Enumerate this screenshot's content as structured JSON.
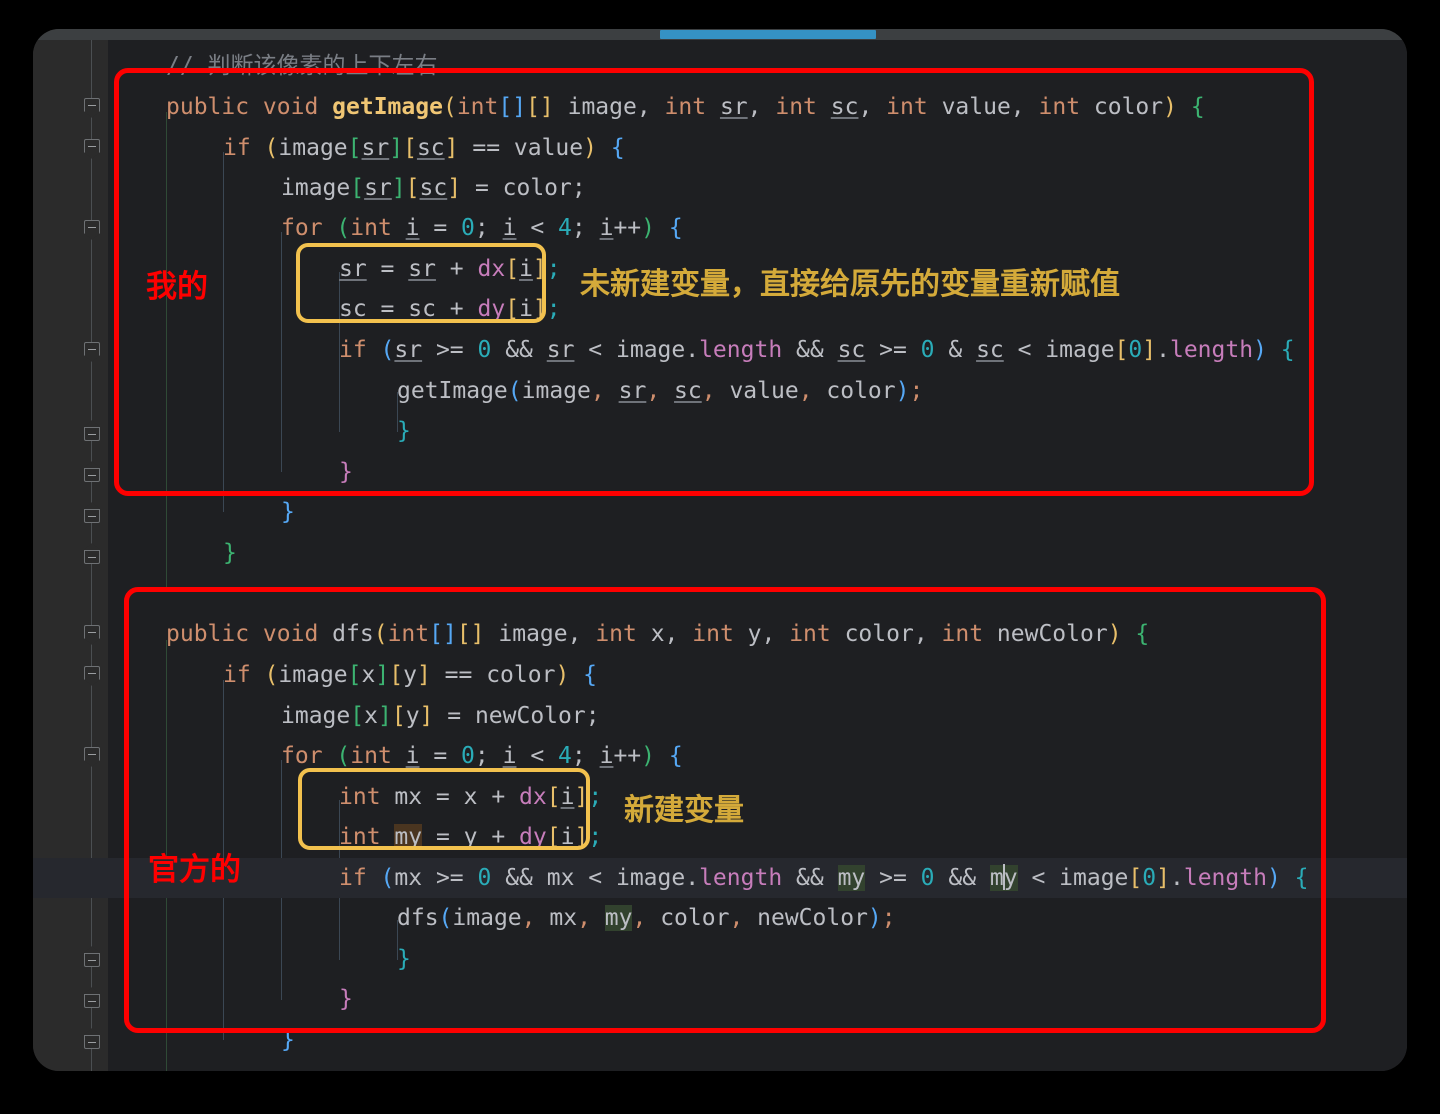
{
  "window": {
    "theme": "dark",
    "background_color": "#1e1f22",
    "chrome_color": "#2b2b2b"
  },
  "topbar": {
    "scrollbar_thumb_color": "#3592c4",
    "name": "horizontal-scrollbar"
  },
  "gutter": {
    "bulb_icon": "lightbulb-intention-icon",
    "fold_icon": "code-fold-icon"
  },
  "code": {
    "comment_line": "// 判断该像素的上下左右",
    "block1": {
      "signature_prefix": "public void ",
      "signature_name": "getImage",
      "l1_a": "(",
      "l1_b": "int",
      "l1_c": "[][] image, ",
      "l1_d": "int",
      "l1_e": " sr, ",
      "l1_f": "int",
      "l1_g": " sc, ",
      "l1_h": "int",
      "l1_i": " value, ",
      "l1_j": "int",
      "l1_k": " color) {",
      "line2": "if (image[sr][sc] == value) {",
      "line3": "image[sr][sc] = color;",
      "line4": "for (int i = 0; i < 4; i++) {",
      "line5": "sr = sr + dx[i];",
      "line6": "sc = sc + dy[i];",
      "line7": "if (sr >= 0 && sr < image.length && sc >= 0 & sc < image[0].length) {",
      "line8": "getImage(image, sr, sc, value, color);",
      "line9": "}",
      "line10": "}",
      "line11": "}",
      "line12": "}"
    },
    "block2": {
      "signature_prefix": "public void ",
      "signature_name": "dfs",
      "l1_k": "(int[][] image, int x, int y, int color, int newColor) {",
      "line2": "if (image[x][y] == color) {",
      "line3": "image[x][y] = newColor;",
      "line4": "for (int i = 0; i < 4; i++) {",
      "line5": "int mx = x + dx[i];",
      "line6": "int my = y + dy[i];",
      "line7": "if (mx >= 0 && mx < image.length && my >= 0 && my < image[0].length) {",
      "line8": "dfs(image, mx, my, color, newColor);",
      "line9": "}",
      "line10": "}",
      "line11": "}"
    }
  },
  "annotations": {
    "red_label_1": "我的",
    "red_label_2": "官方的",
    "gold_note_1": "未新建变量，直接给原先的变量重新赋值",
    "gold_note_2": "新建变量",
    "red_box_color": "#fe0000",
    "yellow_box_color": "#f2c14e",
    "gold_text_color": "#d4aa3a",
    "red_text_color": "#fe0000"
  }
}
